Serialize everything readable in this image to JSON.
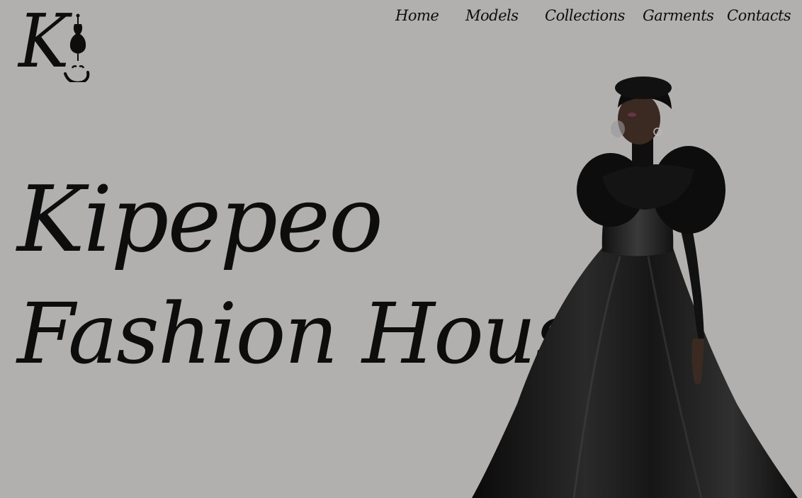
{
  "brand": {
    "logo_letter": "K"
  },
  "nav": {
    "items": [
      {
        "label": "Home"
      },
      {
        "label": "Models"
      },
      {
        "label": "Collections"
      },
      {
        "label": "Garments"
      },
      {
        "label": "Contacts"
      }
    ]
  },
  "hero": {
    "title_line1": "Kipepeo",
    "title_line2": "Fashion House"
  },
  "colors": {
    "background": "#b1b0ae",
    "text": "#0d0d0d",
    "gown": "#141414",
    "skin": "#3b2a22"
  },
  "icons": {
    "logo_ornament": "dress-form-icon"
  }
}
